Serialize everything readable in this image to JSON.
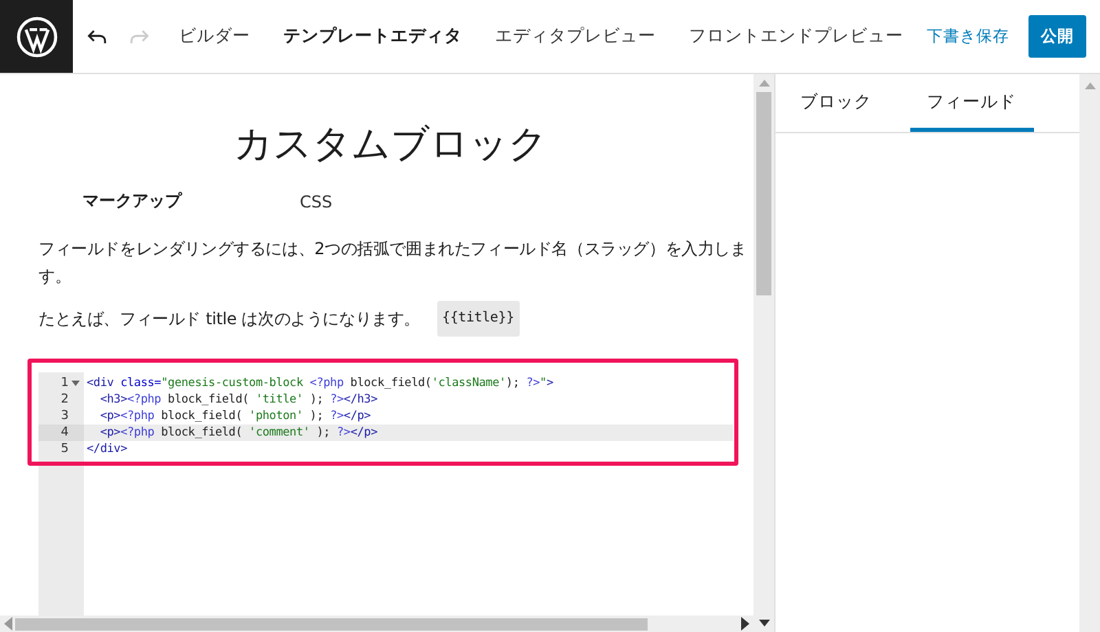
{
  "toolbar": {
    "nav": [
      {
        "label": "ビルダー",
        "selected": false
      },
      {
        "label": "テンプレートエディタ",
        "selected": true
      },
      {
        "label": "エディタプレビュー",
        "selected": false
      },
      {
        "label": "フロントエンドプレビュー",
        "selected": false
      }
    ],
    "undo": {
      "disabled": false
    },
    "redo": {
      "disabled": true
    },
    "save_draft": "下書き保存",
    "publish": "公開"
  },
  "editor": {
    "title": "カスタムブロック",
    "tabs": [
      {
        "label": "マークアップ",
        "selected": true
      },
      {
        "label": "CSS",
        "selected": false
      }
    ],
    "help": "フィールドをレンダリングするには、2つの括弧で囲まれたフィールド名（スラッグ）を入力します。",
    "example": "たとえば、フィールド title は次のようになります。",
    "example_code": "{{title}}",
    "code": [
      {
        "number": "1",
        "foldable": true,
        "active": false,
        "tokens": [
          {
            "kind": "tag",
            "text": "<div"
          },
          {
            "kind": "attr",
            "text": " class="
          },
          {
            "kind": "string",
            "text": "\"genesis-custom-block "
          },
          {
            "kind": "php",
            "text": "<?php"
          },
          {
            "kind": "plain",
            "text": " block_field("
          },
          {
            "kind": "string",
            "text": "'className'"
          },
          {
            "kind": "plain",
            "text": "); "
          },
          {
            "kind": "php",
            "text": "?>"
          },
          {
            "kind": "string",
            "text": "\""
          },
          {
            "kind": "tag",
            "text": ">"
          }
        ]
      },
      {
        "number": "2",
        "foldable": false,
        "active": false,
        "tokens": [
          {
            "kind": "tag",
            "text": "  <h3>"
          },
          {
            "kind": "php",
            "text": "<?php"
          },
          {
            "kind": "plain",
            "text": " block_field( "
          },
          {
            "kind": "string",
            "text": "'title'"
          },
          {
            "kind": "plain",
            "text": " ); "
          },
          {
            "kind": "php",
            "text": "?>"
          },
          {
            "kind": "tag",
            "text": "</h3>"
          }
        ]
      },
      {
        "number": "3",
        "foldable": false,
        "active": false,
        "tokens": [
          {
            "kind": "tag",
            "text": "  <p>"
          },
          {
            "kind": "php",
            "text": "<?php"
          },
          {
            "kind": "plain",
            "text": " block_field( "
          },
          {
            "kind": "string",
            "text": "'photon'"
          },
          {
            "kind": "plain",
            "text": " ); "
          },
          {
            "kind": "php",
            "text": "?>"
          },
          {
            "kind": "tag",
            "text": "</p>"
          }
        ]
      },
      {
        "number": "4",
        "foldable": false,
        "active": true,
        "tokens": [
          {
            "kind": "tag",
            "text": "  <p>"
          },
          {
            "kind": "php",
            "text": "<?php"
          },
          {
            "kind": "plain",
            "text": " block_field( "
          },
          {
            "kind": "string",
            "text": "'comment'"
          },
          {
            "kind": "plain",
            "text": " ); "
          },
          {
            "kind": "php",
            "text": "?>"
          },
          {
            "kind": "tag",
            "text": "</p>"
          }
        ]
      },
      {
        "number": "5",
        "foldable": false,
        "active": false,
        "tokens": [
          {
            "kind": "tag",
            "text": "</div>"
          }
        ]
      }
    ]
  },
  "sidebar": {
    "tabs": [
      {
        "label": "ブロック",
        "selected": false
      },
      {
        "label": "フィールド",
        "selected": true
      }
    ]
  }
}
